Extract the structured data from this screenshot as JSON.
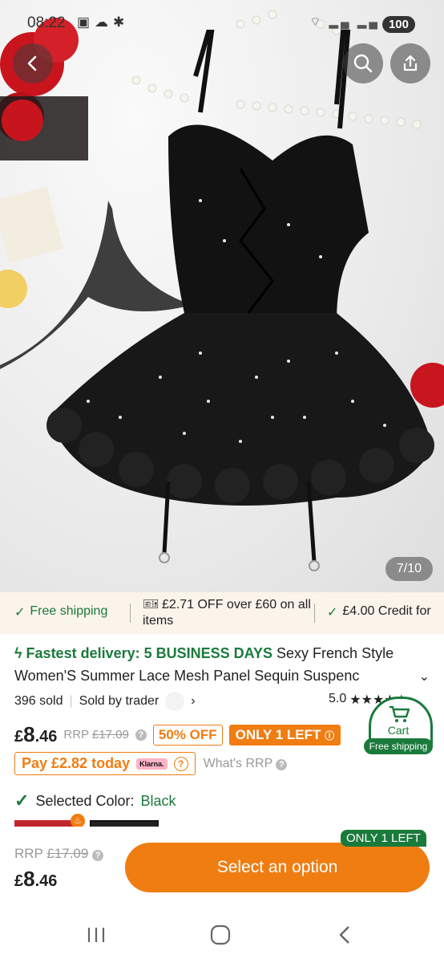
{
  "status_bar": {
    "time": "08:22",
    "battery": "100"
  },
  "gallery": {
    "counter": "7/10"
  },
  "promo": {
    "free_shipping": "Free shipping",
    "discount": "£2.71 OFF over £60 on all items",
    "credit": "£4.00 Credit for"
  },
  "product": {
    "fastest_delivery": "Fastest delivery: 5 BUSINESS DAYS",
    "title_part1": "Sexy French Style",
    "title_part2": "Women'S Summer Lace Mesh Panel Sequin Suspenc",
    "sold": "396 sold",
    "sold_by": "Sold by trader",
    "rating": "5.0",
    "price_symbol": "£",
    "price_int": "8",
    "price_dec": ".46",
    "rrp_label": "RRP",
    "rrp_value": "£17.09",
    "discount_badge": "50% OFF",
    "stock_badge": "ONLY 1 LEFT",
    "pay_today": "Pay £2.82 today",
    "klarna": "Klarna.",
    "whats_rrp": "What's RRP",
    "selected_color_label": "Selected Color:",
    "selected_color_value": "Black"
  },
  "cart_badge": {
    "label": "Cart",
    "shipping": "Free shipping"
  },
  "bottom_bar": {
    "rrp_label": "RRP",
    "rrp_value": "£17.09",
    "price_symbol": "£",
    "price_int": "8",
    "price_dec": ".46",
    "stock_tag": "ONLY 1 LEFT",
    "cta": "Select an option"
  },
  "colors": {
    "orange": "#f07d12",
    "green": "#1a7a3c",
    "promo_bg": "#fbf4ea"
  }
}
